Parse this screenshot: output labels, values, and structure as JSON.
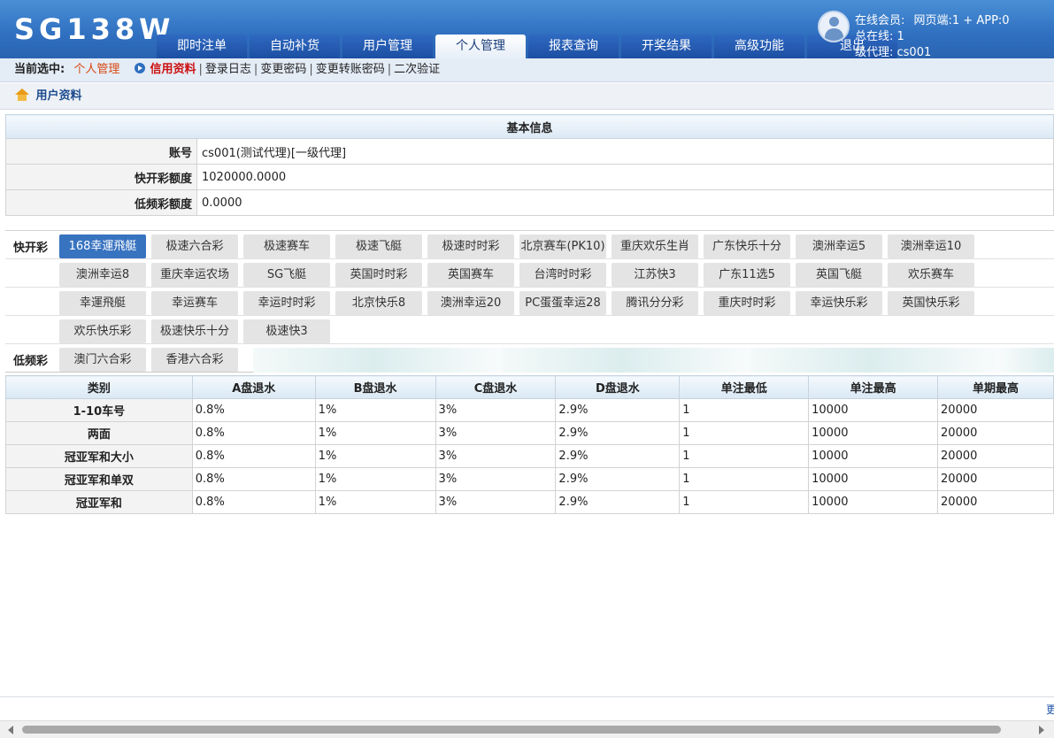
{
  "app": {
    "logo": "SG138W"
  },
  "nav": {
    "tabs": [
      "即时注单",
      "自动补货",
      "用户管理",
      "个人管理",
      "报表查询",
      "开奖结果",
      "高级功能",
      "退出"
    ],
    "active_index": 3
  },
  "user": {
    "online_label": "在线会员:",
    "online_value": "网页端:1 + APP:0",
    "total_online": "总在线: 1",
    "agent": "级代理: cs001"
  },
  "subnav": {
    "current_label": "当前选中:",
    "current": "个人管理",
    "links": [
      "信用资料",
      "登录日志",
      "变更密码",
      "变更转账密码",
      "二次验证"
    ],
    "sep": "|"
  },
  "breadcrumb": "用户资料",
  "basic": {
    "title": "基本信息",
    "rows": [
      {
        "key": "账号",
        "value": "cs001(测试代理)[一级代理]"
      },
      {
        "key": "快开彩额度",
        "value": "1020000.0000"
      },
      {
        "key": "低频彩额度",
        "value": "0.0000"
      }
    ]
  },
  "games": {
    "fast_label": "快开彩",
    "slow_label": "低频彩",
    "fast": [
      "168幸運飛艇",
      "极速六合彩",
      "极速赛车",
      "极速飞艇",
      "极速时时彩",
      "北京赛车(PK10)",
      "重庆欢乐生肖",
      "广东快乐十分",
      "澳洲幸运5",
      "澳洲幸运10",
      "澳洲幸运8",
      "重庆幸运农场",
      "SG飞艇",
      "英国时时彩",
      "英国赛车",
      "台湾时时彩",
      "江苏快3",
      "广东11选5",
      "英国飞艇",
      "欢乐赛车",
      "幸運飛艇",
      "幸运赛车",
      "幸运时时彩",
      "北京快乐8",
      "澳洲幸运20",
      "PC蛋蛋幸运28",
      "腾讯分分彩",
      "重庆时时彩",
      "幸运快乐彩",
      "英国快乐彩",
      "欢乐快乐彩",
      "极速快乐十分",
      "极速快3"
    ],
    "slow": [
      "澳门六合彩",
      "香港六合彩"
    ],
    "active": "168幸運飛艇"
  },
  "odds": {
    "headers": [
      "类别",
      "A盘退水",
      "B盘退水",
      "C盘退水",
      "D盘退水",
      "单注最低",
      "单注最高",
      "单期最高"
    ],
    "rows": [
      [
        "1-10车号",
        "0.8%",
        "1%",
        "3%",
        "2.9%",
        "1",
        "10000",
        "20000"
      ],
      [
        "两面",
        "0.8%",
        "1%",
        "3%",
        "2.9%",
        "1",
        "10000",
        "20000"
      ],
      [
        "冠亚军和大小",
        "0.8%",
        "1%",
        "3%",
        "2.9%",
        "1",
        "10000",
        "20000"
      ],
      [
        "冠亚军和单双",
        "0.8%",
        "1%",
        "3%",
        "2.9%",
        "1",
        "10000",
        "20000"
      ],
      [
        "冠亚军和",
        "0.8%",
        "1%",
        "3%",
        "2.9%",
        "1",
        "10000",
        "20000"
      ]
    ]
  },
  "edge_char": "更"
}
